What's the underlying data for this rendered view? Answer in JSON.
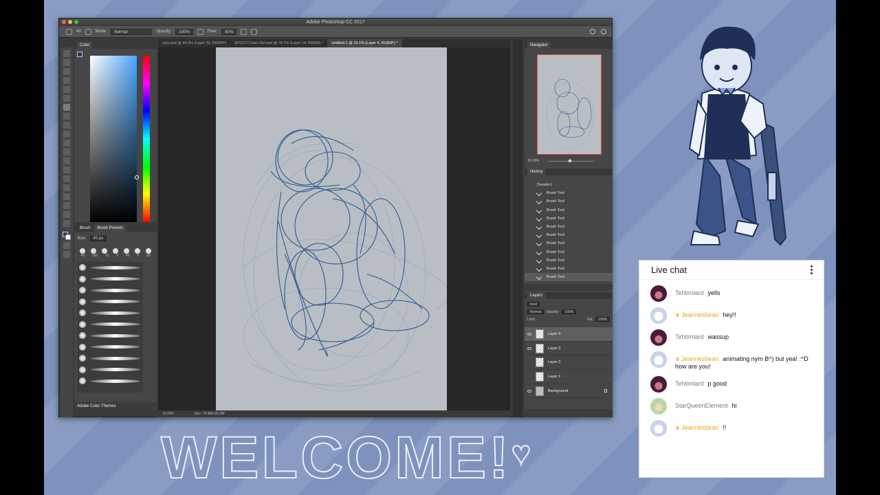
{
  "photoshop": {
    "title": "Adobe Photoshop CC 2017",
    "options_bar": {
      "brush_size": "40",
      "mode_label": "Mode:",
      "mode_value": "Normal",
      "opacity_label": "Opacity:",
      "opacity_value": "100%",
      "flow_label": "Flow:",
      "flow_value": "80%"
    },
    "tabs": [
      "nym.psd @ 44.9% (Layer 33, RGB/8*)",
      "[072217] Dain Ref.psd @ 78.7% (Layer 14, RGB/8) *",
      "Untitled-1 @ 15.1% (Layer 4, RGB/8*) *"
    ],
    "color_panel": {
      "tab": "Color"
    },
    "brush_panel": {
      "tabs": [
        "Brush",
        "Brush Presets"
      ],
      "size_label": "Size:",
      "size_value": "40 px",
      "tip_sizes": [
        "40",
        "200",
        "15",
        "9",
        "40",
        "9",
        "25"
      ],
      "footer": "Adobe Color Themes"
    },
    "status": {
      "zoom": "15.06%",
      "doc": "Doc: 79.9M/120.0M"
    },
    "navigator": {
      "tab": "Navigator",
      "zoom": "15.06%"
    },
    "history": {
      "tab": "History",
      "items": [
        "Deselect",
        "Brush Tool",
        "Brush Tool",
        "Brush Tool",
        "Brush Tool",
        "Brush Tool",
        "Brush Tool",
        "Brush Tool",
        "Brush Tool",
        "Brush Tool",
        "Brush Tool",
        "Brush Tool"
      ]
    },
    "layers": {
      "tab": "Layers",
      "kind": "Kind",
      "blend": "Normal",
      "opacity_label": "Opacity:",
      "opacity_value": "100%",
      "lock_label": "Lock:",
      "fill_label": "Fill:",
      "fill_value": "100%",
      "items": [
        "Layer 4",
        "Layer 3",
        "Layer 2",
        "Layer 1",
        "Background"
      ]
    }
  },
  "welcome_text": "WELCOME!",
  "chat": {
    "title": "Live chat",
    "messages": [
      {
        "author": "Tehtimlard",
        "text": "yells",
        "owner": false
      },
      {
        "author": "Jeannesbean",
        "text": "hey!!",
        "owner": true
      },
      {
        "author": "Tehtimlard",
        "text": "wassup",
        "owner": false
      },
      {
        "author": "Jeannesbean",
        "text": "animating nym B^) but yea! :^D how are you!",
        "owner": true
      },
      {
        "author": "Tehtimlard",
        "text": "p good",
        "owner": false
      },
      {
        "author": "StarQueenElement",
        "text": "hi",
        "owner": false
      },
      {
        "author": "Jeannesbean",
        "text": "!!",
        "owner": true
      }
    ]
  },
  "colors": {
    "background_stripe_a": "#8a9cc4",
    "background_stripe_b": "#7f92bd",
    "sketch_blue": "#2c5a8e",
    "owner_gold": "#e9a527"
  }
}
